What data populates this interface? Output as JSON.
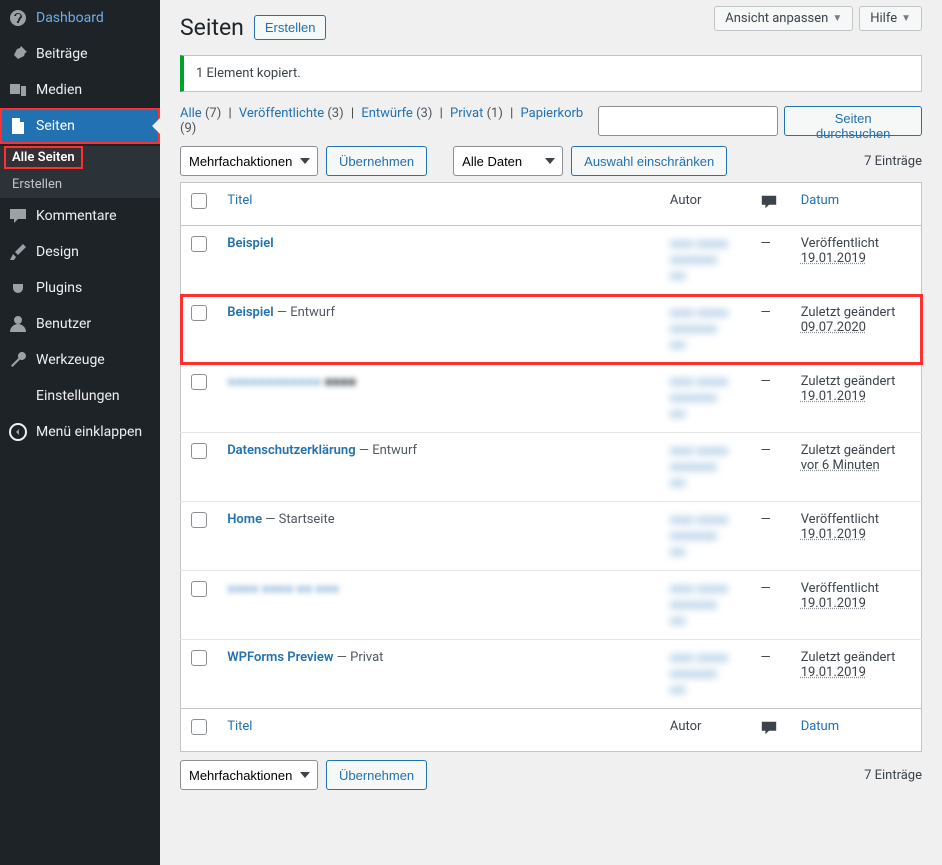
{
  "top": {
    "screen_options": "Ansicht anpassen",
    "help": "Hilfe"
  },
  "sidebar": {
    "items": [
      {
        "id": "dashboard",
        "label": "Dashboard"
      },
      {
        "id": "posts",
        "label": "Beiträge"
      },
      {
        "id": "media",
        "label": "Medien"
      },
      {
        "id": "pages",
        "label": "Seiten"
      },
      {
        "id": "comments",
        "label": "Kommentare"
      },
      {
        "id": "appearance",
        "label": "Design"
      },
      {
        "id": "plugins",
        "label": "Plugins"
      },
      {
        "id": "users",
        "label": "Benutzer"
      },
      {
        "id": "tools",
        "label": "Werkzeuge"
      },
      {
        "id": "settings",
        "label": "Einstellungen"
      },
      {
        "id": "collapse",
        "label": "Menü einklappen"
      }
    ],
    "submenu": {
      "all": "Alle Seiten",
      "add": "Erstellen"
    }
  },
  "page": {
    "heading": "Seiten",
    "add_new": "Erstellen",
    "notice": "1 Element kopiert."
  },
  "filters": {
    "all": "Alle",
    "all_count": "(7)",
    "published": "Veröffentlichte",
    "published_count": "(3)",
    "drafts": "Entwürfe",
    "drafts_count": "(3)",
    "private": "Privat",
    "private_count": "(1)",
    "trash": "Papierkorb",
    "trash_count": "(9)"
  },
  "search": {
    "button": "Seiten durchsuchen"
  },
  "bulk": {
    "label": "Mehrfachaktionen",
    "apply": "Übernehmen"
  },
  "datefilter": {
    "label": "Alle Daten",
    "apply": "Auswahl einschränken"
  },
  "count": "7 Einträge",
  "columns": {
    "title": "Titel",
    "author": "Autor",
    "date": "Datum"
  },
  "dash": "—",
  "rows": [
    {
      "title": "Beispiel",
      "state": "",
      "blurred_title": false,
      "blurred_state": false,
      "author_blur": "■■■ ■■■■",
      "date_status": "Veröffentlicht",
      "date_value": "19.01.2019"
    },
    {
      "title": "Beispiel",
      "state": " — Entwurf",
      "blurred_title": false,
      "blurred_state": false,
      "author_blur": "■■■ ■■■■",
      "date_status": "Zuletzt geändert",
      "date_value": "09.07.2020"
    },
    {
      "title": "■■■■■■■■■■■■",
      "state": " ■■■■",
      "blurred_title": true,
      "blurred_state": true,
      "author_blur": "■■■ ■■■■",
      "date_status": "Zuletzt geändert",
      "date_value": "19.01.2019"
    },
    {
      "title": "Datenschutzerklärung",
      "state": " — Entwurf",
      "blurred_title": false,
      "blurred_state": false,
      "author_blur": "■■■ ■■■■",
      "date_status": "Zuletzt geändert",
      "date_value": "vor 6 Minuten"
    },
    {
      "title": "Home",
      "state": " — Startseite",
      "blurred_title": false,
      "blurred_state": false,
      "author_blur": "■■■ ■■■■",
      "date_status": "Veröffentlicht",
      "date_value": "19.01.2019"
    },
    {
      "title": "■■■■ ■■■■ ■■ ■■■",
      "state": "",
      "blurred_title": true,
      "blurred_state": false,
      "author_blur": "■■■ ■■■■",
      "date_status": "Veröffentlicht",
      "date_value": "19.01.2019"
    },
    {
      "title": "WPForms Preview",
      "state": " — Privat",
      "blurred_title": false,
      "blurred_state": false,
      "author_blur": "■■■ ■■■■",
      "date_status": "Zuletzt geändert",
      "date_value": "19.01.2019"
    }
  ]
}
